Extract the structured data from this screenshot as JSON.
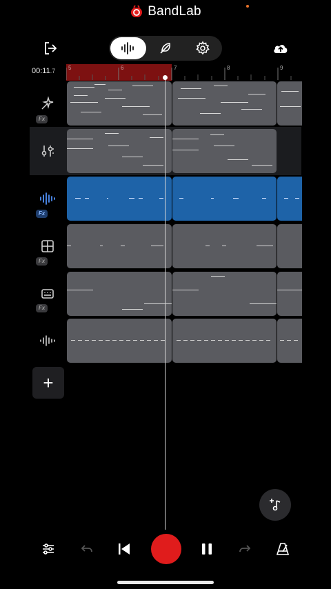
{
  "app": {
    "brand": "BandLab",
    "brand_color": "#e01c1c"
  },
  "header": {
    "exit_icon": "exit-icon",
    "modes": [
      {
        "icon": "waveform-icon",
        "active": true
      },
      {
        "icon": "feather-icon",
        "active": false
      },
      {
        "icon": "gear-icon",
        "active": false
      }
    ],
    "upload_icon": "cloud-upload-icon"
  },
  "timeline": {
    "time_main": "00:11",
    "time_frac": ".7",
    "ticks": [
      "5",
      "6",
      "7",
      "8",
      "9"
    ]
  },
  "tracks": [
    {
      "icon": "vocal-sparkle-icon",
      "fx": "Fx",
      "type": "midi"
    },
    {
      "icon": "mixer-sliders-icon",
      "fx": "",
      "type": "midi",
      "selected": true
    },
    {
      "icon": "waveform-icon",
      "fx": "Fx",
      "type": "audio",
      "color": "#1e63a8"
    },
    {
      "icon": "drum-pads-icon",
      "fx": "Fx",
      "type": "midi"
    },
    {
      "icon": "keyboard-icon",
      "fx": "Fx",
      "type": "midi"
    },
    {
      "icon": "waveform-icon",
      "fx": "",
      "type": "audio"
    }
  ],
  "add_track_label": "+",
  "transport": {
    "items": [
      "settings-sliders-icon",
      "undo-icon",
      "skip-back-icon",
      "record-button",
      "pause-icon",
      "redo-icon",
      "metronome-icon"
    ]
  }
}
